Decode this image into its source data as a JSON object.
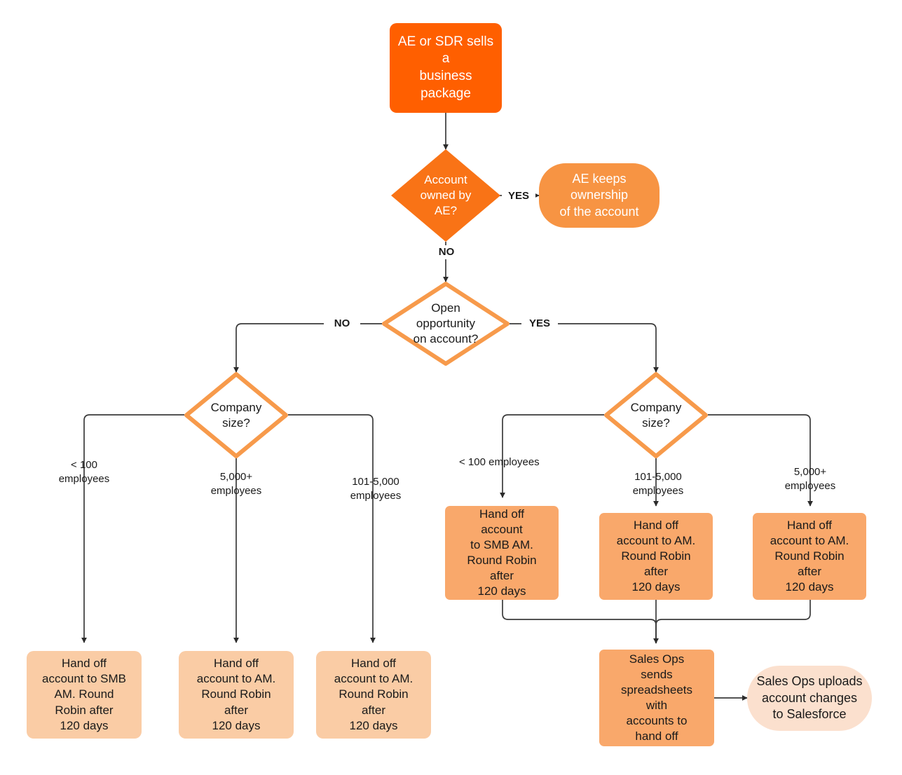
{
  "diagram": {
    "title": "Account handoff flowchart",
    "colors": {
      "start_fill": "#FF5F00",
      "decision_filled_fill": "#F97316",
      "decision_open_stroke": "#F79A4B",
      "pill_mid_fill": "#F79443",
      "box_mid_fill": "#F9A86B",
      "box_pale_fill": "#FACCA5",
      "pill_pale_fill": "#FBE0CE",
      "connector": "#3b3b3b"
    }
  },
  "nodes": {
    "start": "AE or SDR sells\na\nbusiness\npackage",
    "decision_owned": "Account\nowned by\nAE?",
    "ae_keeps": "AE keeps\nownership\nof the account",
    "decision_open_opp": "Open\nopportunity\non account?",
    "company_size_left": "Company\nsize?",
    "company_size_right": "Company\nsize?",
    "left_small": "Hand off\naccount to SMB\nAM. Round\nRobin after\n120 days",
    "left_large": "Hand off\naccount to AM.\nRound Robin\nafter\n120 days",
    "left_mid": "Hand off\naccount to AM.\nRound Robin\nafter\n120 days",
    "right_small": "Hand off\naccount\nto SMB AM.\nRound Robin\nafter\n120 days",
    "right_mid": "Hand off\naccount to AM.\nRound Robin\nafter\n120 days",
    "right_large": "Hand off\naccount to AM.\nRound Robin\nafter\n120 days",
    "sales_ops_sends": "Sales Ops\nsends\nspreadsheets\nwith\naccounts to\nhand off",
    "sales_ops_uploads": "Sales Ops uploads\naccount changes\nto Salesforce"
  },
  "edges": {
    "owned_yes": "YES",
    "owned_no": "NO",
    "opp_no": "NO",
    "opp_yes": "YES",
    "left_b1": "< 100\nemployees",
    "left_b2": "5,000+\nemployees",
    "left_b3": "101-5,000\nemployees",
    "right_b1": "< 100 employees",
    "right_b2": "101-5,000\nemployees",
    "right_b3": "5,000+\nemployees"
  }
}
